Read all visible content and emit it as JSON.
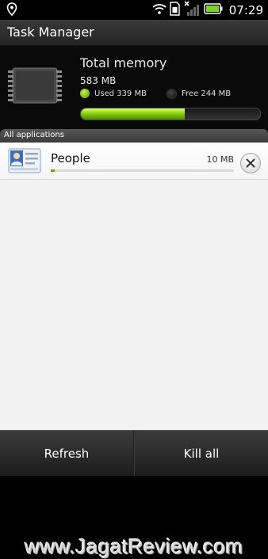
{
  "status_bar": {
    "time": "07:29",
    "icons": [
      "location-pin-icon",
      "wifi-icon",
      "sim-icon",
      "signal-icon",
      "battery-icon"
    ]
  },
  "header": {
    "title": "Task Manager"
  },
  "memory": {
    "title": "Total memory",
    "total": "583 MB",
    "used_label": "Used 339 MB",
    "free_label": "Free 244 MB",
    "used_fraction": 0.581,
    "used_color": "#7cc400"
  },
  "section": {
    "label": "All applications"
  },
  "apps": [
    {
      "name": "People",
      "size": "10 MB",
      "icon": "contact-card-icon",
      "usage_fraction": 0.02
    }
  ],
  "watermark": "www.JagatReview.com",
  "bottom_bar": {
    "refresh_label": "Refresh",
    "kill_all_label": "Kill all"
  }
}
